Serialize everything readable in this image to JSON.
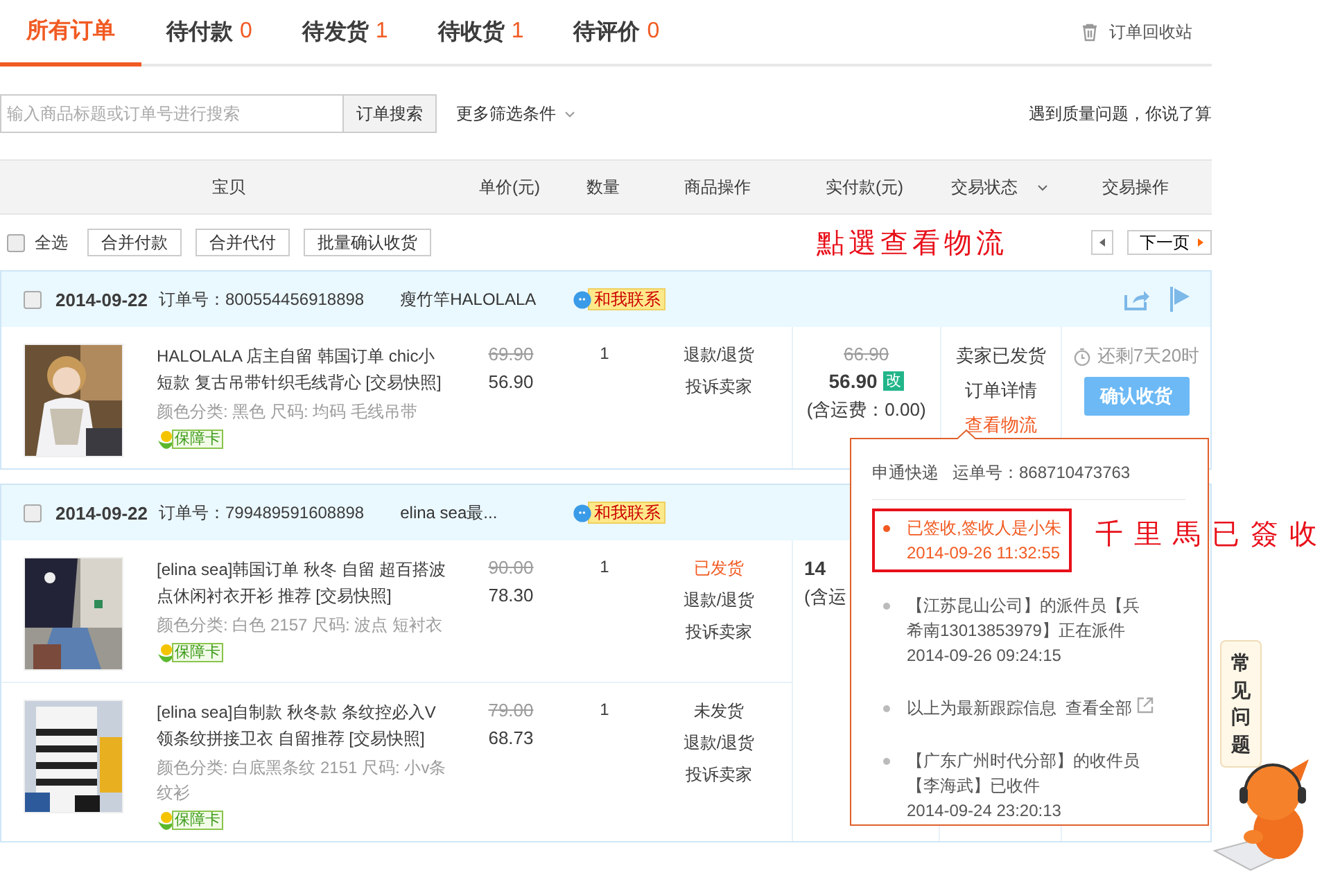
{
  "tabs": [
    {
      "label": "所有订单",
      "selected": true
    },
    {
      "label": "待付款",
      "count": "0",
      "selected": false
    },
    {
      "label": "待发货",
      "count": "1",
      "selected": false
    },
    {
      "label": "待收货",
      "count": "1",
      "selected": false
    },
    {
      "label": "待评价",
      "count": "0",
      "selected": false
    }
  ],
  "recycle_bin": "订单回收站",
  "search": {
    "placeholder": "输入商品标题或订单号进行搜索",
    "button": "订单搜索",
    "more_filters": "更多筛选条件"
  },
  "quality_note": "遇到质量问题，你说了算",
  "columns": [
    {
      "label": "宝贝"
    },
    {
      "label": "单价(元)"
    },
    {
      "label": "数量"
    },
    {
      "label": "商品操作"
    },
    {
      "label": "实付款(元)"
    },
    {
      "label": "交易状态",
      "dropdown": true
    },
    {
      "label": "交易操作"
    }
  ],
  "toolbar": {
    "select_all": {
      "label": "全选",
      "checked": false
    },
    "buttons": [
      "合并付款",
      "合并代付",
      "批量确认收货"
    ],
    "next_page": "下一页"
  },
  "note_view_logistics": "點選查看物流",
  "note_signed": "千里馬已簽收",
  "orders": [
    {
      "checked": false,
      "date": "2014-09-22",
      "order_no_label": "订单号：",
      "order_no": "800554456918898",
      "seller": "瘦竹竿HALOLALA",
      "contact": "和我联系",
      "header_icons": true,
      "items": [
        {
          "title": "HALOLALA 店主自留 韩国订单 chic小短款 复古吊带针织毛线背心 [交易快照]",
          "spec": "颜色分类: 黑色 尺码: 均码 毛线吊带",
          "guarantee": "保障卡",
          "original_price": "69.90",
          "price": "56.90",
          "quantity": "1",
          "ops": [
            {
              "text": "退款/退货",
              "highlight": false
            },
            {
              "text": "投诉卖家",
              "highlight": false
            }
          ]
        }
      ],
      "paid": {
        "original": "66.90",
        "total": "56.90",
        "modified": "改",
        "shipping": "(含运费：0.00)"
      },
      "status": [
        {
          "text": "卖家已发货",
          "highlight": false
        },
        {
          "text": "订单详情",
          "highlight": false
        },
        {
          "text": "查看物流",
          "highlight": true
        }
      ],
      "action": {
        "countdown": "还剩7天20时",
        "button": "确认收货"
      }
    },
    {
      "checked": false,
      "date": "2014-09-22",
      "order_no_label": "订单号：",
      "order_no": "799489591608898",
      "seller": "elina sea最...",
      "contact": "和我联系",
      "header_icons": false,
      "items": [
        {
          "title": "[elina sea]韩国订单 秋冬 自留 超百搭波点休闲衬衣开衫 推荐 [交易快照]",
          "spec": "颜色分类: 白色 2157 尺码: 波点 短衬衣",
          "guarantee": "保障卡",
          "original_price": "90.00",
          "price": "78.30",
          "quantity": "1",
          "ops": [
            {
              "text": "已发货",
              "highlight": true
            },
            {
              "text": "退款/退货",
              "highlight": false
            },
            {
              "text": "投诉卖家",
              "highlight": false
            }
          ]
        },
        {
          "title": "[elina sea]自制款 秋冬款 条纹控必入V领条纹拼接卫衣 自留推荐 [交易快照]",
          "spec": "颜色分类: 白底黑条纹 2151 尺码: 小v条纹衫",
          "guarantee": "保障卡",
          "original_price": "79.00",
          "price": "68.73",
          "quantity": "1",
          "ops": [
            {
              "text": "未发货",
              "highlight": false
            },
            {
              "text": "退款/退货",
              "highlight": false
            },
            {
              "text": "投诉卖家",
              "highlight": false
            }
          ]
        }
      ],
      "paid": {
        "total": "14",
        "shipping": "(含运"
      }
    }
  ],
  "logistics": {
    "carrier": "申通快递",
    "waybill_label": "运单号：",
    "waybill": "868710473763",
    "events": [
      {
        "kind": "event",
        "text": "已签收,签收人是小朱",
        "time": "2014-09-26 11:32:55",
        "latest": true
      },
      {
        "kind": "event",
        "text": "【江苏昆山公司】的派件员【兵希南13013853979】正在派件",
        "time": "2014-09-26 09:24:15",
        "latest": false
      },
      {
        "kind": "note",
        "text": "以上为最新跟踪信息",
        "link": "查看全部",
        "latest": false
      },
      {
        "kind": "event",
        "text": "【广东广州时代分部】的收件员【李海武】已收件",
        "time": "2014-09-24 23:20:13",
        "latest": false
      }
    ]
  },
  "help": "常见问题"
}
